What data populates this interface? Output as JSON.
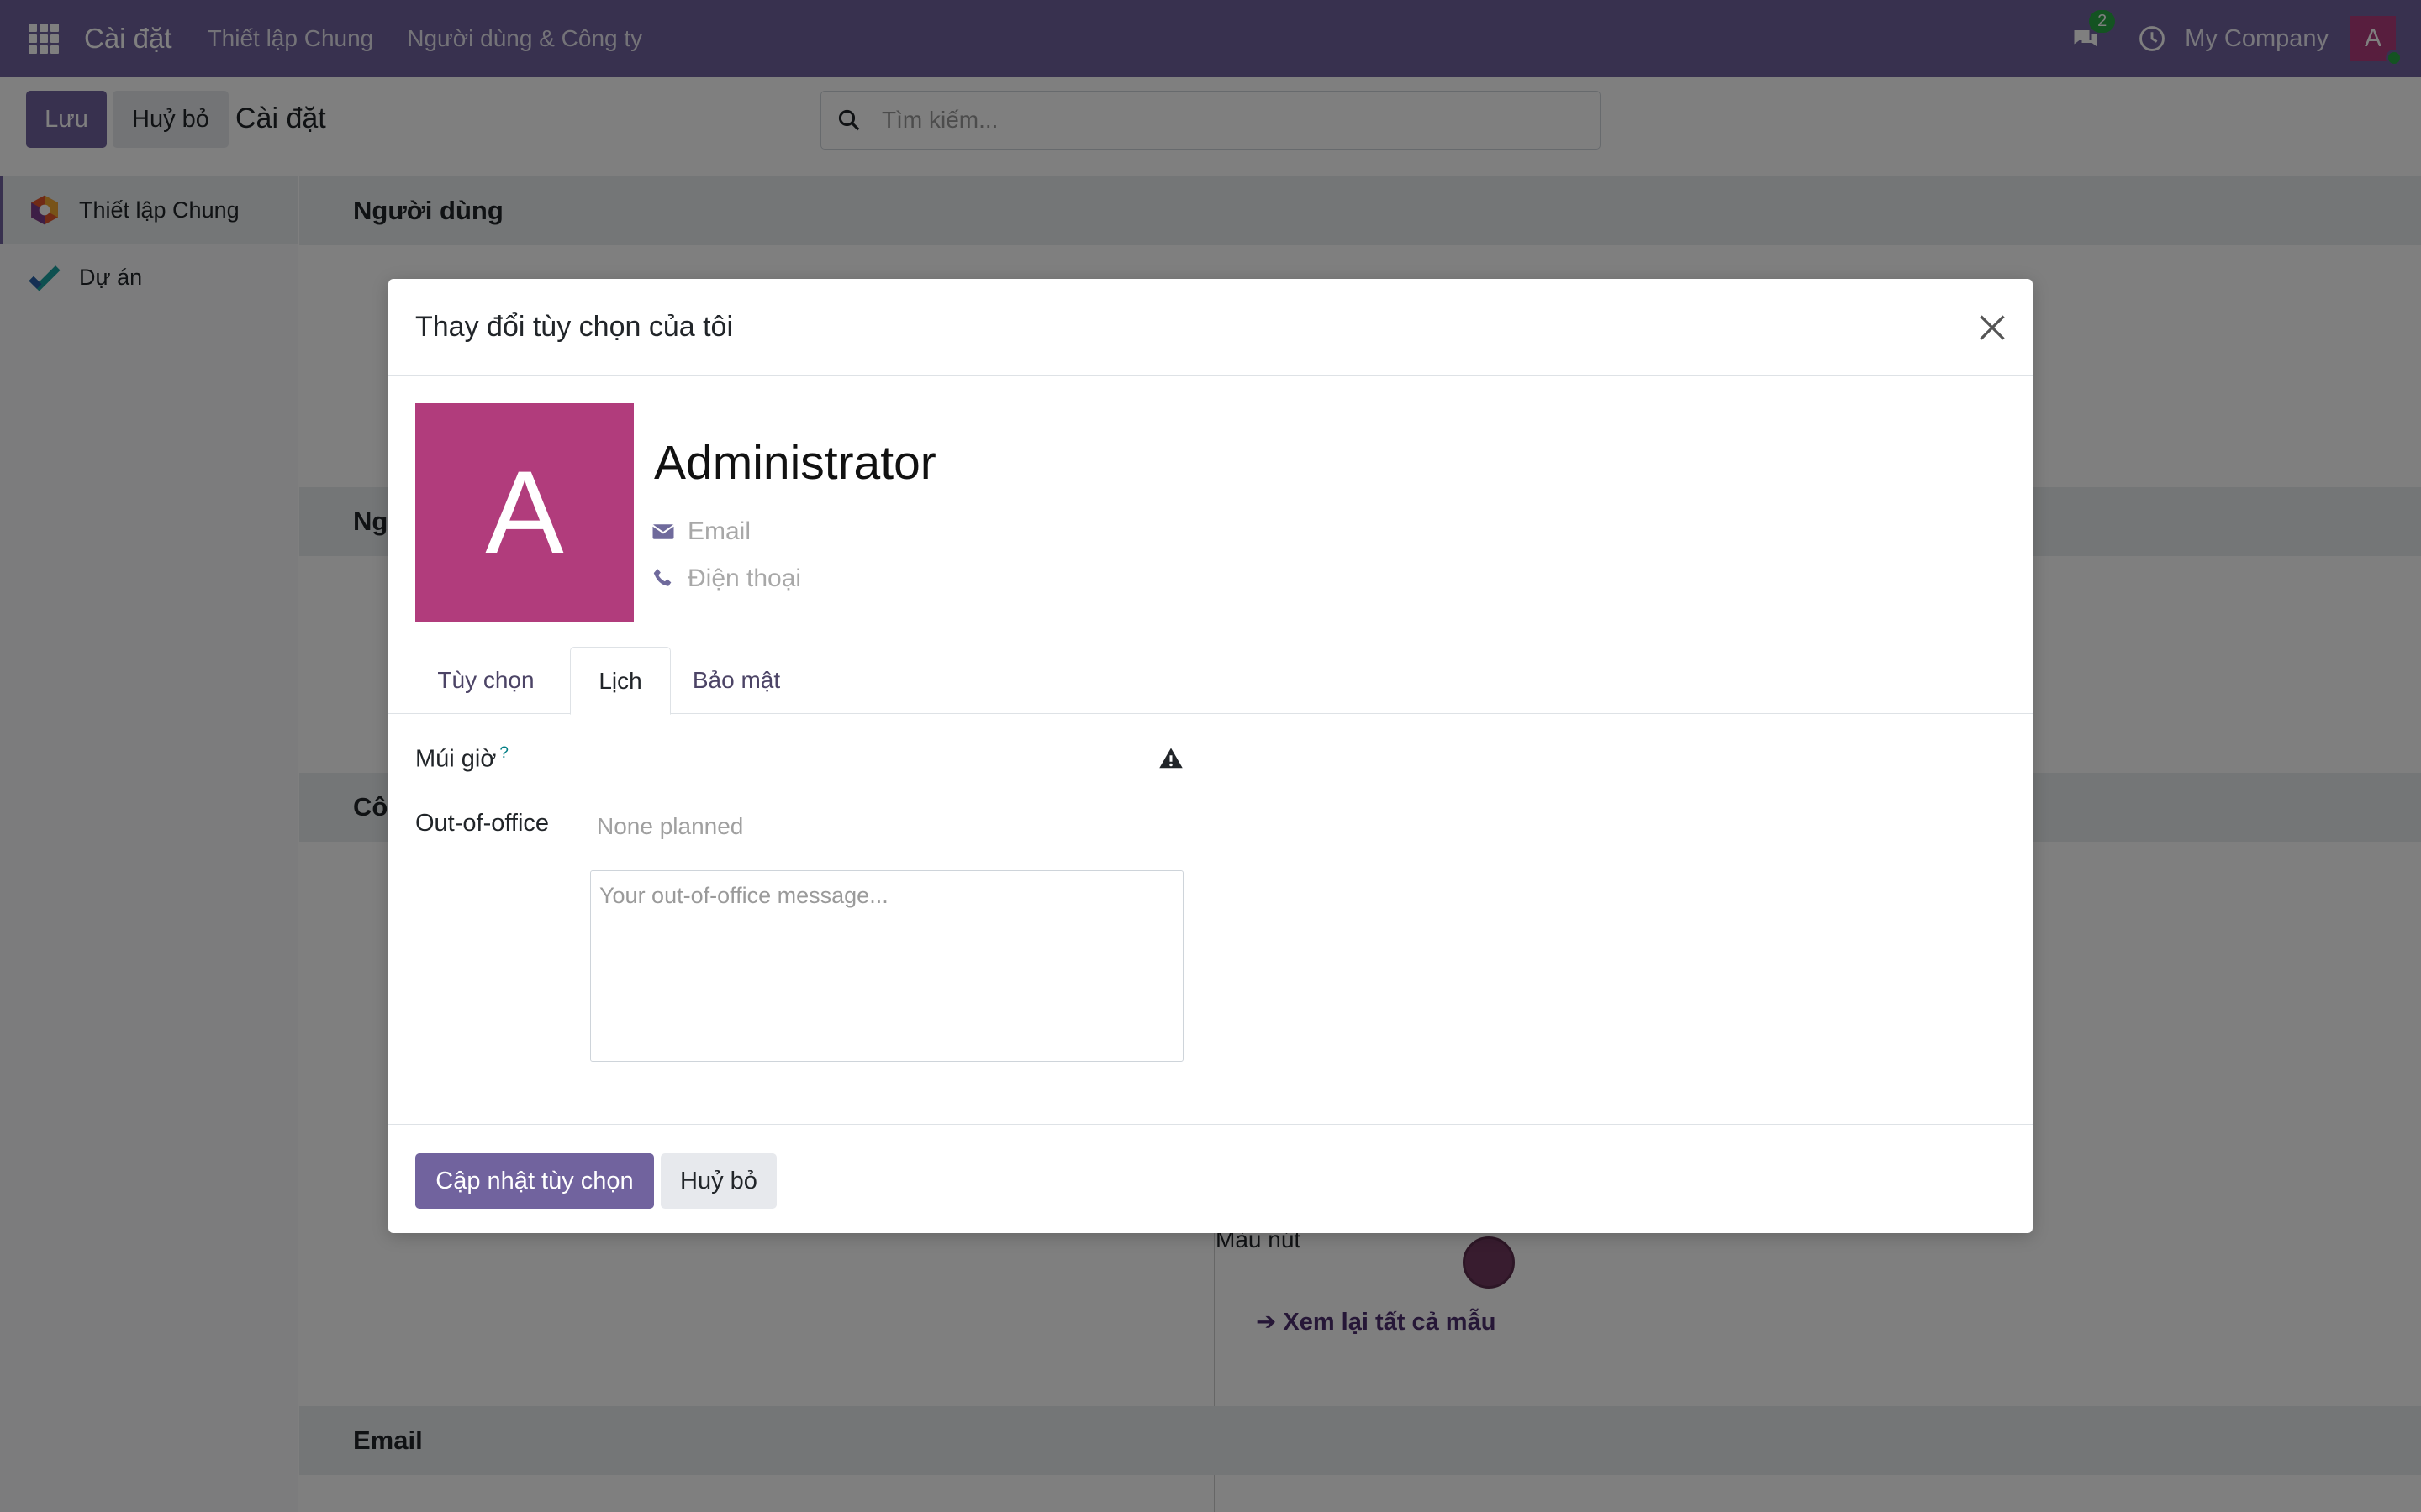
{
  "navbar": {
    "app_name": "Cài đặt",
    "menu": [
      "Thiết lập Chung",
      "Người dùng & Công ty"
    ],
    "chat_badge": "2",
    "company": "My Company",
    "avatar_letter": "A"
  },
  "control": {
    "save_label": "Lưu",
    "discard_label": "Huỷ bỏ",
    "title": "Cài đặt",
    "search_placeholder": "Tìm kiếm..."
  },
  "sidebar": {
    "items": [
      {
        "label": "Thiết lập Chung"
      },
      {
        "label": "Dự án"
      }
    ]
  },
  "content": {
    "sections": [
      "Người dùng",
      "Ng",
      "Cô",
      "Email"
    ],
    "button_color_label": "Màu nút",
    "review_link": "Xem lại tất cả mẫu"
  },
  "modal": {
    "title": "Thay đổi tùy chọn của tôi",
    "avatar_letter": "A",
    "user_name": "Administrator",
    "email_placeholder": "Email",
    "phone_placeholder": "Điện thoại",
    "tabs": [
      {
        "label": "Tùy chọn",
        "active": false
      },
      {
        "label": "Lịch",
        "active": true
      },
      {
        "label": "Bảo mật",
        "active": false
      }
    ],
    "timezone_label": "Múi giờ",
    "timezone_help": "?",
    "ooo_label": "Out-of-office",
    "ooo_value": "None planned",
    "ooo_placeholder": "Your out-of-office message...",
    "update_label": "Cập nhật tùy chọn",
    "cancel_label": "Huỷ bỏ"
  },
  "colors": {
    "brand": "#71639e",
    "avatar": "#b13c7c"
  }
}
